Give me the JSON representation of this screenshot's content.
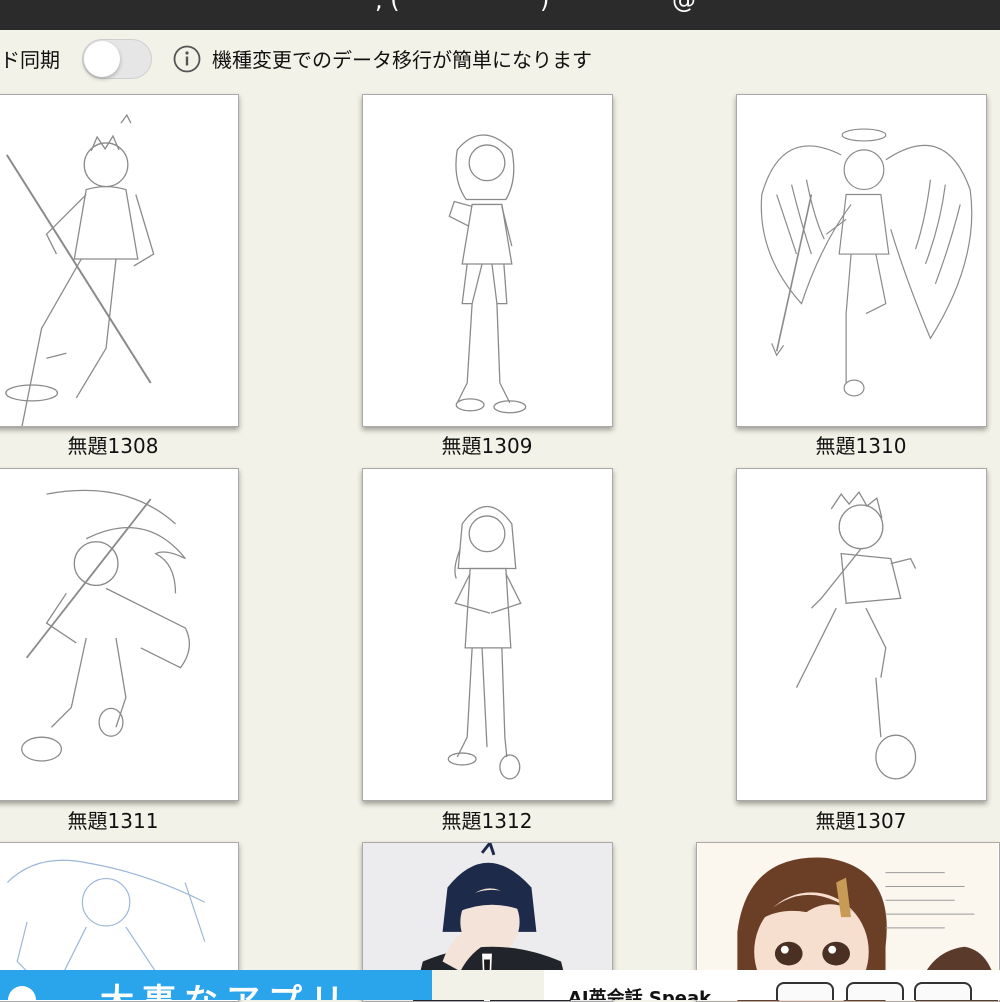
{
  "status_bar": {
    "visible_glyphs": [
      ", (",
      ")",
      "@",
      "\""
    ]
  },
  "sync": {
    "label": "ド同期",
    "toggle_on": false,
    "info_text": "機種変更でのデータ移行が簡単になります"
  },
  "gallery": {
    "items": [
      {
        "title": "無題1308"
      },
      {
        "title": "無題1309"
      },
      {
        "title": "無題1310"
      },
      {
        "title": "無題1311"
      },
      {
        "title": "無題1312"
      },
      {
        "title": "無題1307"
      },
      {
        "title": ""
      },
      {
        "title": ""
      },
      {
        "title": ""
      }
    ]
  },
  "ad_banner": {
    "left_text": "大事なアプリ",
    "right_text": "AI英会話 Speak",
    "left_color": "#2aa4ea"
  },
  "colors": {
    "background": "#f3f2e8",
    "top_bar": "#2b2b2b",
    "sketch_line": "#8a8a8a"
  }
}
